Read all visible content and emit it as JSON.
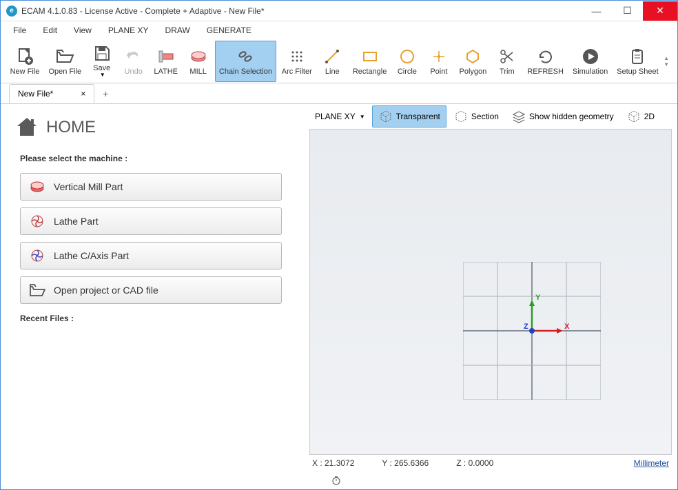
{
  "title": "ECAM 4.1.0.83 - License Active -  Complete + Adaptive - New File*",
  "menu": [
    "File",
    "Edit",
    "View",
    "PLANE XY",
    "DRAW",
    "GENERATE"
  ],
  "toolbar": [
    {
      "id": "new-file",
      "label": "New File"
    },
    {
      "id": "open-file",
      "label": "Open File"
    },
    {
      "id": "save",
      "label": "Save"
    },
    {
      "id": "undo",
      "label": "Undo",
      "disabled": true
    },
    {
      "id": "lathe",
      "label": "LATHE"
    },
    {
      "id": "mill",
      "label": "MILL"
    },
    {
      "id": "chain-selection",
      "label": "Chain Selection",
      "selected": true
    },
    {
      "id": "arc-filter",
      "label": "Arc Filter"
    },
    {
      "id": "line",
      "label": "Line"
    },
    {
      "id": "rectangle",
      "label": "Rectangle"
    },
    {
      "id": "circle",
      "label": "Circle"
    },
    {
      "id": "point",
      "label": "Point"
    },
    {
      "id": "polygon",
      "label": "Polygon"
    },
    {
      "id": "trim",
      "label": "Trim"
    },
    {
      "id": "refresh",
      "label": "REFRESH"
    },
    {
      "id": "simulation",
      "label": "Simulation"
    },
    {
      "id": "setup-sheet",
      "label": "Setup Sheet"
    }
  ],
  "tab": {
    "label": "New File*"
  },
  "home": {
    "title": "HOME",
    "select_label": "Please select the machine :",
    "buttons": [
      {
        "id": "vertical-mill",
        "label": "Vertical Mill Part"
      },
      {
        "id": "lathe-part",
        "label": "Lathe Part"
      },
      {
        "id": "lathe-caxis",
        "label": "Lathe C/Axis Part"
      },
      {
        "id": "open-project",
        "label": "Open project or CAD file"
      }
    ],
    "recent_label": "Recent Files :"
  },
  "view_toolbar": {
    "plane": "PLANE XY",
    "transparent": "Transparent",
    "section": "Section",
    "hidden": "Show hidden geometry",
    "mode2d": "2D"
  },
  "axes": {
    "x": "X",
    "y": "Y",
    "z": "Z"
  },
  "status": {
    "x": "X : 21.3072",
    "y": "Y : 265.6366",
    "z": "Z : 0.0000",
    "unit": "Millimeter"
  }
}
